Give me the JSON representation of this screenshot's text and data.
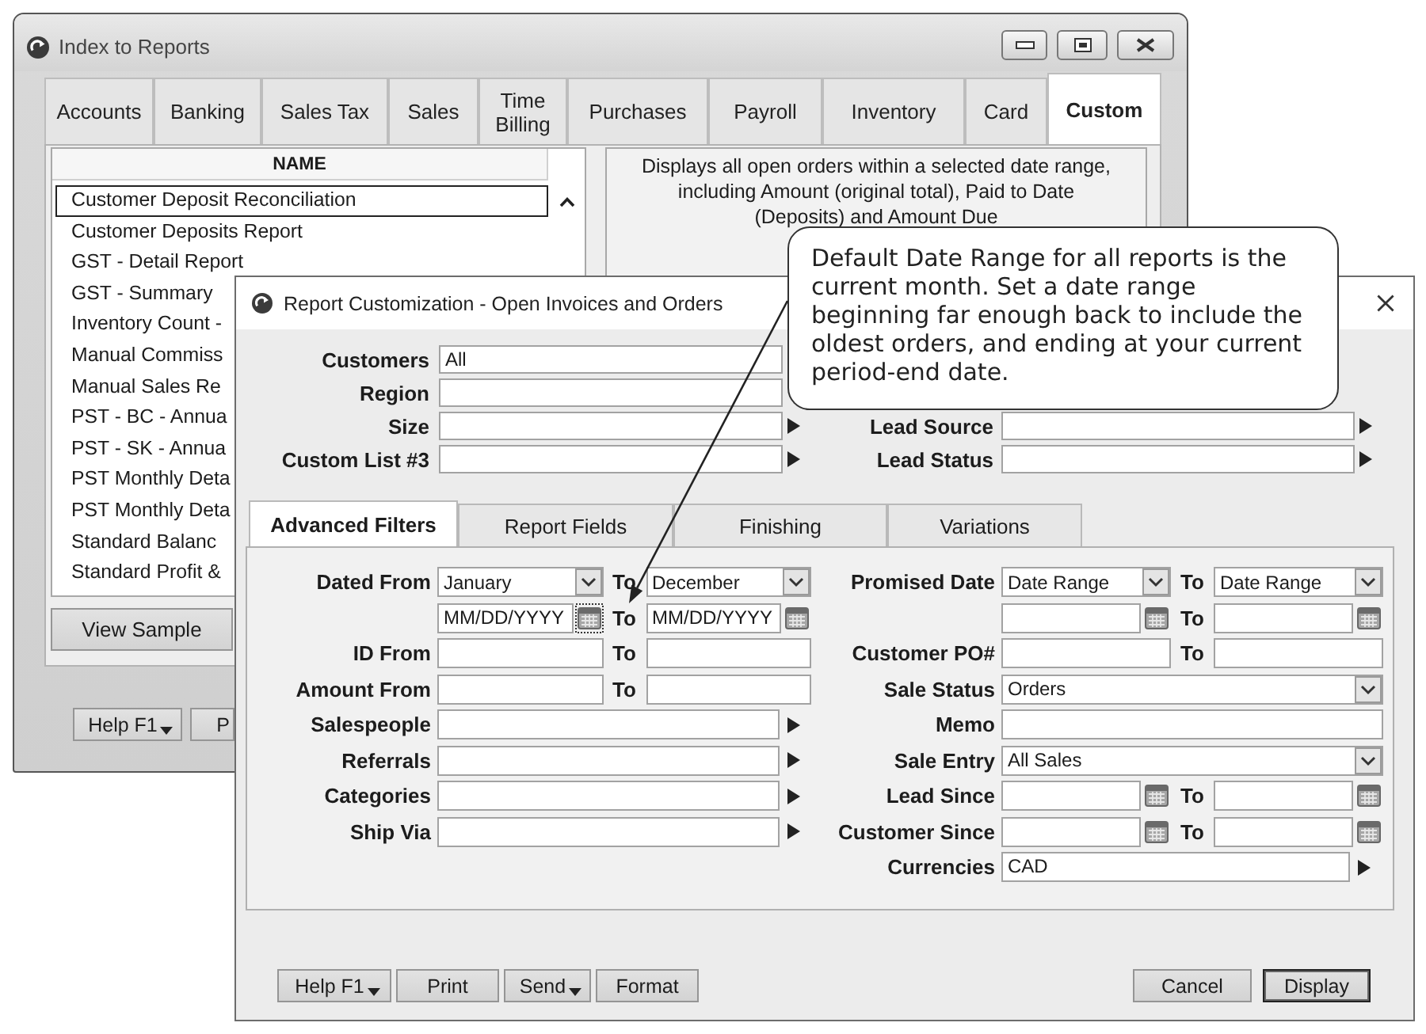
{
  "reports_window": {
    "title": "Index to Reports",
    "tabs": [
      {
        "label": "Accounts",
        "selected": false
      },
      {
        "label": "Banking",
        "selected": false
      },
      {
        "label": "Sales Tax",
        "selected": false
      },
      {
        "label": "Sales",
        "selected": false
      },
      {
        "label": "Time Billing",
        "selected": false
      },
      {
        "label": "Purchases",
        "selected": false
      },
      {
        "label": "Payroll",
        "selected": false
      },
      {
        "label": "Inventory",
        "selected": false
      },
      {
        "label": "Card",
        "selected": false
      },
      {
        "label": "Custom",
        "selected": true
      }
    ],
    "report_list": {
      "header": "NAME",
      "items": [
        {
          "label": "Customer Deposit Reconciliation",
          "selected": true
        },
        {
          "label": "Customer Deposits Report",
          "selected": false
        },
        {
          "label": "GST - Detail Report",
          "selected": false
        },
        {
          "label": "GST - Summary",
          "selected": false
        },
        {
          "label": "Inventory Count -",
          "selected": false
        },
        {
          "label": "Manual Commiss",
          "selected": false
        },
        {
          "label": "Manual Sales Re",
          "selected": false
        },
        {
          "label": "PST - BC - Annua",
          "selected": false
        },
        {
          "label": "PST - SK - Annua",
          "selected": false
        },
        {
          "label": "PST Monthly Deta",
          "selected": false
        },
        {
          "label": "PST Monthly Deta",
          "selected": false
        },
        {
          "label": "Standard Balanc",
          "selected": false
        },
        {
          "label": "Standard Profit &",
          "selected": false
        }
      ]
    },
    "description": "Displays all open orders within a selected date range, including Amount (original total), Paid to Date (Deposits) and Amount Due",
    "view_sample_button": "View Sample",
    "footer_buttons": [
      {
        "label": "Help F1",
        "dropdown": true
      },
      {
        "label": "P",
        "dropdown": false
      }
    ]
  },
  "customization_dialog": {
    "title": "Report Customization - Open Invoices and Orders",
    "top_fields": [
      {
        "kind": "text",
        "label": "Customers",
        "value": "All"
      },
      {
        "kind": "text",
        "label": "Region"
      },
      {
        "kind": "lookup",
        "label": "Size"
      },
      {
        "kind": "lookup",
        "label": "Custom List #3"
      }
    ],
    "top_fields_right": [
      {
        "kind": "lookup",
        "label": "Lead Source"
      },
      {
        "kind": "lookup",
        "label": "Lead Status"
      }
    ],
    "tabs": [
      {
        "label": "Advanced Filters",
        "selected": true
      },
      {
        "label": "Report Fields",
        "selected": false
      },
      {
        "label": "Finishing",
        "selected": false
      },
      {
        "label": "Variations",
        "selected": false
      }
    ],
    "filters_left": [
      {
        "kind": "select_range",
        "label": "Dated From",
        "from": "January",
        "to_label": "To",
        "to": "December"
      },
      {
        "kind": "date_range",
        "from": "MM/DD/YYYY",
        "to_label": "To",
        "to": "MM/DD/YYYY",
        "from_calendar_focused": true
      },
      {
        "kind": "text_range",
        "label": "ID From",
        "to_label": "To"
      },
      {
        "kind": "text_range",
        "label": "Amount From",
        "to_label": "To"
      },
      {
        "kind": "lookup",
        "label": "Salespeople"
      },
      {
        "kind": "lookup",
        "label": "Referrals"
      },
      {
        "kind": "lookup",
        "label": "Categories"
      },
      {
        "kind": "lookup",
        "label": "Ship Via"
      }
    ],
    "filters_right": [
      {
        "kind": "select_range",
        "label": "Promised Date",
        "from": "Date Range",
        "to_label": "To",
        "to": "Date Range"
      },
      {
        "kind": "date_range",
        "to_label": "To",
        "from_calendar_focused": false
      },
      {
        "kind": "text_range",
        "label": "Customer PO#",
        "to_label": "To"
      },
      {
        "kind": "select",
        "label": "Sale Status",
        "value": "Orders"
      },
      {
        "kind": "text",
        "label": "Memo"
      },
      {
        "kind": "select",
        "label": "Sale Entry",
        "value": "All Sales"
      },
      {
        "kind": "date_range",
        "label": "Lead Since",
        "to_label": "To",
        "from_calendar_focused": false
      },
      {
        "kind": "date_range",
        "label": "Customer Since",
        "to_label": "To",
        "from_calendar_focused": false
      },
      {
        "kind": "lookup",
        "label": "Currencies",
        "value": "CAD"
      }
    ],
    "buttons_left": [
      {
        "label": "Help F1",
        "dropdown": true
      },
      {
        "label": "Print",
        "dropdown": false
      },
      {
        "label": "Send",
        "dropdown": true
      },
      {
        "label": "Format",
        "dropdown": false
      }
    ],
    "buttons_right": [
      {
        "label": "Cancel",
        "default": false
      },
      {
        "label": "Display",
        "default": true
      }
    ]
  },
  "callout": {
    "text": "Default Date Range for all reports is the current month. Set a date range beginning far enough back to include the oldest orders, and ending at your current period-end date."
  }
}
